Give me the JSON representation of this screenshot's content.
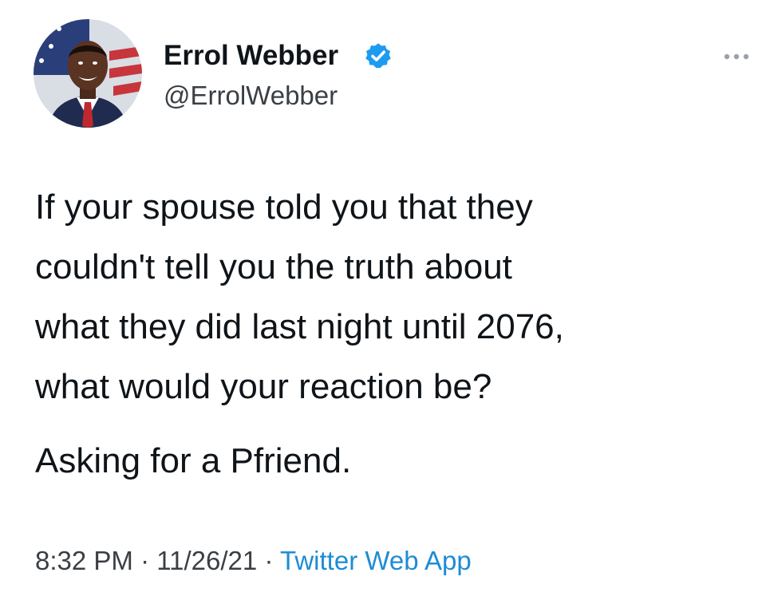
{
  "author": {
    "display_name": "Errol Webber",
    "handle": "@ErrolWebber",
    "verified": true
  },
  "tweet": {
    "lines": [
      "If your spouse told you that they",
      "couldn't tell you the truth about",
      "what they did last night until 2076,",
      "what would your reaction be?"
    ],
    "closing": "Asking for a Pfriend."
  },
  "meta": {
    "time": "8:32 PM",
    "separator": "·",
    "date": "11/26/21",
    "source": "Twitter Web App"
  },
  "icons": {
    "verified": "verified-badge-icon",
    "more": "more-options-icon"
  },
  "colors": {
    "accent": "#1d9bf0",
    "source_link": "#1d8cd6",
    "text": "#0f1419",
    "secondary_text": "#3a3f44"
  }
}
